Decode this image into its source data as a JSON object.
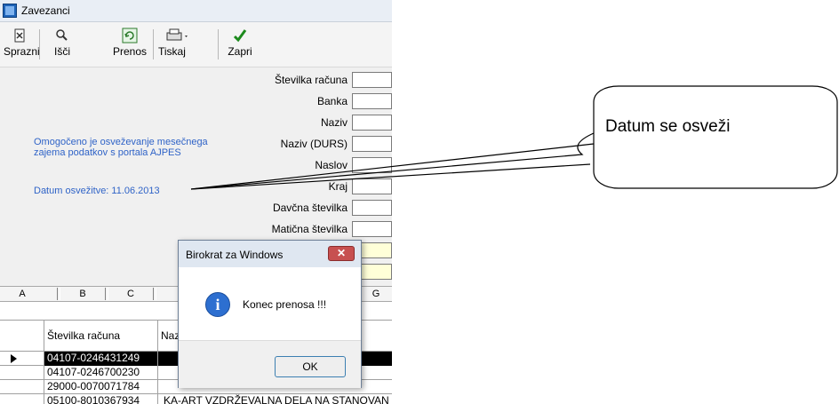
{
  "window": {
    "title": "Zavezanci"
  },
  "toolbar": {
    "buttons": [
      {
        "label": "Sprazni",
        "icon": "clear-icon"
      },
      {
        "label": "Išči",
        "icon": "search-icon"
      },
      {
        "label": "Prenos",
        "icon": "transfer-icon"
      },
      {
        "label": "Tiskaj",
        "icon": "printer-icon"
      },
      {
        "label": "Zapri",
        "icon": "checkmark-icon"
      }
    ]
  },
  "form": {
    "info_text": "Omogočeno je osveževanje mesečnega zajema podatkov s portala AJPES",
    "refresh_date": "Datum osvežitve: 11.06.2013",
    "fields": [
      {
        "label": "Številka računa"
      },
      {
        "label": "Banka"
      },
      {
        "label": "Naziv"
      },
      {
        "label": "Naziv (DURS)"
      },
      {
        "label": "Naslov"
      },
      {
        "label": "Kraj"
      },
      {
        "label": "Davčna številka"
      },
      {
        "label": "Matična številka"
      }
    ]
  },
  "grid": {
    "column_headers": [
      "A",
      "B",
      "C",
      "G"
    ],
    "table_headers": [
      "Številka računa",
      "Naz"
    ],
    "rows": [
      {
        "account": "04107-0246431249",
        "name": ""
      },
      {
        "account": "04107-0246700230",
        "name": ""
      },
      {
        "account": "29000-0070071784",
        "name": ""
      },
      {
        "account": "05100-8010367934",
        "name": "KA-ART VZDRŽEVALNA DELA NA STANOVAN"
      }
    ]
  },
  "dialog": {
    "title": "Birokrat za Windows",
    "close_glyph": "✕",
    "message": "Konec prenosa !!!",
    "ok_label": "OK"
  },
  "callout": {
    "text": "Datum se osveži"
  },
  "colors": {
    "info_text": "#2f63c7",
    "selected_row": "#000000",
    "dialog_close": "#c75050",
    "ok_border": "#3c7fb1"
  }
}
